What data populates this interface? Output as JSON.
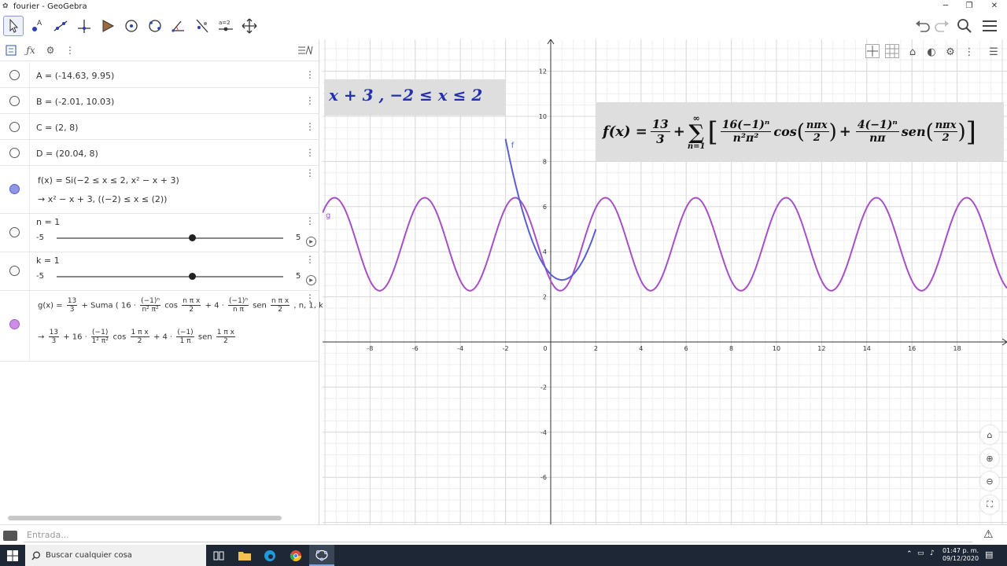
{
  "window": {
    "title": "fourier - GeoGebra"
  },
  "algebra": {
    "input_placeholder": "Entrada...",
    "items": [
      {
        "text": "A = (-14.63, 9.95)"
      },
      {
        "text": "B = (-2.01, 10.03)"
      },
      {
        "text": "C = (2, 8)"
      },
      {
        "text": "D = (20.04, 8)"
      }
    ],
    "f_definition": "f(x) = Si(−2 ≤ x ≤ 2, x² − x + 3)",
    "f_result": "→   x² − x + 3,    ((−2) ≤ x ≤ (2))",
    "sliders": [
      {
        "label": "n = 1",
        "min": "-5",
        "max": "5",
        "value": 1
      },
      {
        "label": "k = 1",
        "min": "-5",
        "max": "5",
        "value": 1
      }
    ],
    "g_definition": {
      "prefix": "g(x) =",
      "frac1_num": "13",
      "frac1_den": "3",
      "mid1": "+ Suma ( 16 ·",
      "frac2_num": "(−1)ⁿ",
      "frac2_den": "n² π²",
      "mid2": "cos",
      "frac3_num": "n π x",
      "frac3_den": "2",
      "mid3": "+ 4 ·",
      "frac4_num": "(−1)ⁿ",
      "frac4_den": "n π",
      "mid4": "sen",
      "frac5_num": "n π x",
      "frac5_den": "2",
      "suffix": ", n, 1, k )"
    },
    "g_result": {
      "prefix": "→",
      "frac1_num": "13",
      "frac1_den": "3",
      "mid1": "+ 16 ·",
      "frac2_num": "(−1)",
      "frac2_den": "1² π²",
      "mid2": "cos",
      "frac3_num": "1 π x",
      "frac3_den": "2",
      "mid3": "+ 4 ·",
      "frac4_num": "(−1)",
      "frac4_den": "1 π",
      "mid4": "sen",
      "frac5_num": "1 π x",
      "frac5_den": "2"
    }
  },
  "graphics": {
    "overlay_left": "x + 3   ,  −2 ≤ x ≤ 2",
    "overlay_formula": {
      "lhs": "f(x) =",
      "frac_num": "13",
      "frac_den": "3",
      "plus": "+",
      "sum_top": "∞",
      "sum_sym": "∑",
      "sum_bottom": "n=1",
      "term1_num": "16(−1)ⁿ",
      "term1_den": "n²π²",
      "cos_text": "cos",
      "arg_num": "nπx",
      "arg_den": "2",
      "plus2": "+",
      "term2_num": "4(−1)ⁿ",
      "term2_den": "nπ",
      "sen_text": "sen"
    },
    "label_f": "f",
    "label_g": "g",
    "x_ticks": [
      "-8",
      "-6",
      "-4",
      "-2",
      "0",
      "2",
      "4",
      "6",
      "8",
      "10",
      "12",
      "14",
      "16",
      "18"
    ],
    "y_ticks": [
      "12",
      "10",
      "8",
      "6",
      "4",
      "2",
      "-2",
      "-4",
      "-6"
    ],
    "colors": {
      "f": "#5a5fd0",
      "g": "#a74fc7",
      "axis": "#333333",
      "grid_major": "#d9d9d9",
      "grid_minor": "#efefef"
    }
  },
  "taskbar": {
    "search_placeholder": "Buscar cualquier cosa",
    "time": "01:47 p. m.",
    "date": "09/12/2020"
  }
}
